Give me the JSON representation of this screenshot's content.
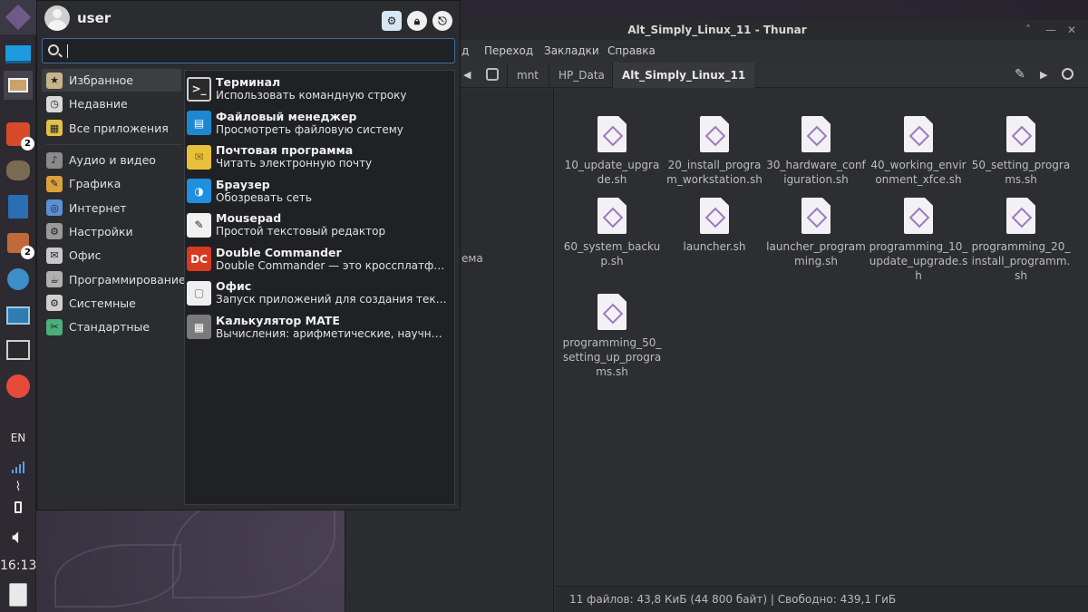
{
  "desktop_partial_text": "ема",
  "panel": {
    "items": [
      {
        "name": "app-menu-icon",
        "badge": ""
      },
      {
        "name": "show-desktop-icon",
        "badge": ""
      },
      {
        "name": "file-manager-icon",
        "badge": ""
      },
      {
        "name": "double-commander-icon",
        "badge": "2"
      },
      {
        "name": "gimp-icon",
        "badge": ""
      },
      {
        "name": "writer-icon",
        "badge": ""
      },
      {
        "name": "software-manager-icon",
        "badge": "2"
      },
      {
        "name": "settings-icon",
        "badge": ""
      },
      {
        "name": "remote-desktop-icon",
        "badge": ""
      },
      {
        "name": "terminal-icon",
        "badge": ""
      },
      {
        "name": "yandex-browser-icon",
        "badge": ""
      }
    ],
    "keyboard_layout": "EN",
    "clock": "16:13"
  },
  "thunar": {
    "title": "Alt_Simply_Linux_11 - Thunar",
    "menu": {
      "edit_partial": "д",
      "go": "Переход",
      "bookmarks": "Закладки",
      "help": "Справка"
    },
    "path": [
      "mnt",
      "HP_Data",
      "Alt_Simply_Linux_11"
    ],
    "files": [
      "10_update_upgrade.sh",
      "20_install_program_workstation.sh",
      "30_hardware_configuration.sh",
      "40_working_environment_xfce.sh",
      "50_setting_programs.sh",
      "60_system_backup.sh",
      "launcher.sh",
      "launcher_programming.sh",
      "programming_10_update_upgrade.sh",
      "programming_20_install_programm.sh",
      "programming_50_setting_up_programs.sh"
    ],
    "status": "11 файлов: 43,8 КиБ (44 800 байт)  |  Свободно: 439,1 ГиБ"
  },
  "menu": {
    "username": "user",
    "search_value": "",
    "categories": [
      {
        "label": "Избранное",
        "icon": "favorites-icon"
      },
      {
        "label": "Недавние",
        "icon": "recent-icon"
      },
      {
        "label": "Все приложения",
        "icon": "all-apps-icon"
      },
      {
        "label": "Аудио и видео",
        "icon": "multimedia-icon"
      },
      {
        "label": "Графика",
        "icon": "graphics-icon"
      },
      {
        "label": "Интернет",
        "icon": "internet-icon"
      },
      {
        "label": "Настройки",
        "icon": "settings-icon"
      },
      {
        "label": "Офис",
        "icon": "office-icon"
      },
      {
        "label": "Программирование",
        "icon": "development-icon"
      },
      {
        "label": "Системные",
        "icon": "system-icon"
      },
      {
        "label": "Стандартные",
        "icon": "accessories-icon"
      }
    ],
    "apps": [
      {
        "name": "Терминал",
        "desc": "Использовать командную строку",
        "icon": "terminal-icon"
      },
      {
        "name": "Файловый менеджер",
        "desc": "Просмотреть файловую систему",
        "icon": "file-manager-icon"
      },
      {
        "name": "Почтовая программа",
        "desc": "Читать электронную почту",
        "icon": "mail-icon"
      },
      {
        "name": "Браузер",
        "desc": "Обозревать сеть",
        "icon": "browser-icon"
      },
      {
        "name": "Mousepad",
        "desc": "Простой текстовый редактор",
        "icon": "text-editor-icon"
      },
      {
        "name": "Double Commander",
        "desc": "Double Commander — это кроссплатформ…",
        "icon": "double-commander-icon"
      },
      {
        "name": "Офис",
        "desc": "Запуск приложений для создания текстов…",
        "icon": "office-icon"
      },
      {
        "name": "Калькулятор MATE",
        "desc": "Вычисления: арифметические, научные и …",
        "icon": "calculator-icon"
      }
    ]
  },
  "colors": {
    "accent": "#3a6fa6",
    "menu_bg": "#2a2c30",
    "panel_bg": "#2d2b31"
  }
}
